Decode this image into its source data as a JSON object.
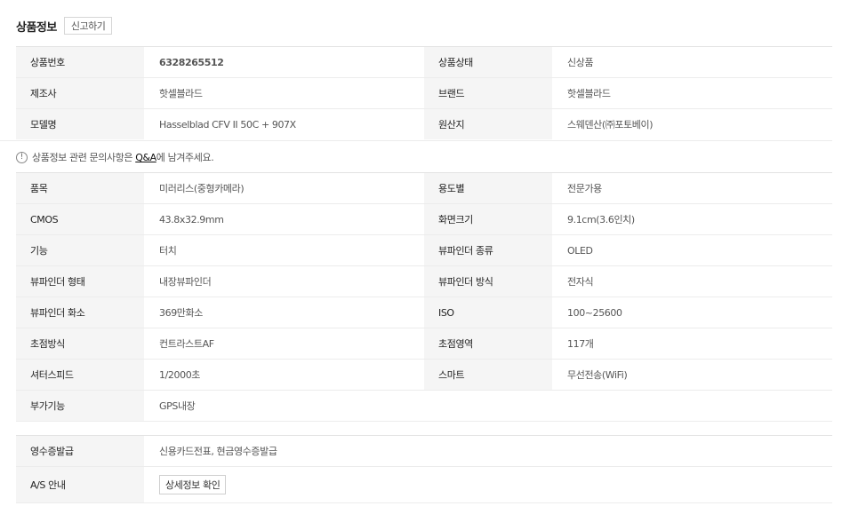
{
  "header": {
    "title": "상품정보",
    "report_label": "신고하기"
  },
  "basic_info": [
    {
      "k1": "상품번호",
      "v1": "6328265512",
      "k2": "상품상태",
      "v2": "신상품"
    },
    {
      "k1": "제조사",
      "v1": "핫셀블라드",
      "k2": "브랜드",
      "v2": "핫셀블라드"
    },
    {
      "k1": "모델명",
      "v1": "Hasselblad CFV II 50C + 907X",
      "k2": "원산지",
      "v2": "스웨덴산(㈜포토베이)"
    }
  ],
  "notice": {
    "prefix": "상품정보 관련 문의사항은 ",
    "link": "Q&A",
    "suffix": "에 남겨주세요."
  },
  "specs": [
    {
      "k1": "품목",
      "v1": "미러리스(중형카메라)",
      "k2": "용도별",
      "v2": "전문가용"
    },
    {
      "k1": "CMOS",
      "v1": "43.8x32.9mm",
      "k2": "화면크기",
      "v2": "9.1cm(3.6인치)"
    },
    {
      "k1": "기능",
      "v1": "터치",
      "k2": "뷰파인더 종류",
      "v2": "OLED"
    },
    {
      "k1": "뷰파인더 형태",
      "v1": "내장뷰파인더",
      "k2": "뷰파인더 방식",
      "v2": "전자식"
    },
    {
      "k1": "뷰파인더 화소",
      "v1": "369만화소",
      "k2": "ISO",
      "v2": "100~25600"
    },
    {
      "k1": "초점방식",
      "v1": "컨트라스트AF",
      "k2": "초점영역",
      "v2": "117개"
    },
    {
      "k1": "셔터스피드",
      "v1": "1/2000초",
      "k2": "스마트",
      "v2": "무선전송(WiFi)"
    },
    {
      "k1": "부가기능",
      "v1": "GPS내장",
      "k2": "",
      "v2": ""
    }
  ],
  "extra": {
    "receipt_label": "영수증발급",
    "receipt_value": "신용카드전표, 현금영수증발급",
    "as_label": "A/S 안내",
    "as_button": "상세정보 확인"
  },
  "icons": {
    "notice": "info-icon"
  }
}
